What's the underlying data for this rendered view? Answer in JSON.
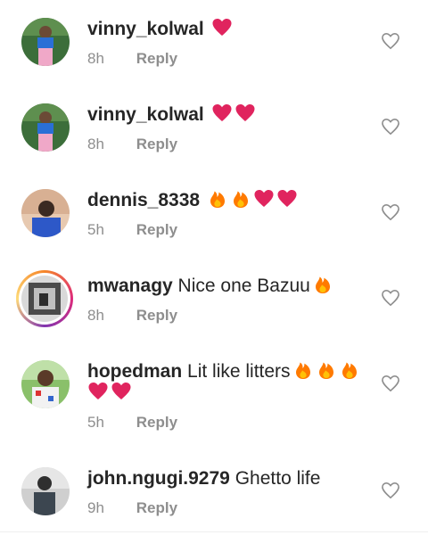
{
  "comments": [
    {
      "username": "vinny_kolwal",
      "text": "",
      "emoji": [
        "heart"
      ],
      "time": "8h",
      "reply": "Reply",
      "avatar": "photo-pink"
    },
    {
      "username": "vinny_kolwal",
      "text": "",
      "emoji": [
        "heart",
        "heart"
      ],
      "time": "8h",
      "reply": "Reply",
      "avatar": "photo-pink"
    },
    {
      "username": "dennis_8338",
      "text": "",
      "emoji": [
        "fire",
        "fire",
        "heart",
        "heart"
      ],
      "time": "5h",
      "reply": "Reply",
      "avatar": "photo-blue"
    },
    {
      "username": "mwanagy",
      "text": "Nice one Bazuu",
      "emoji": [
        "fire"
      ],
      "time": "8h",
      "reply": "Reply",
      "avatar": "photo-story"
    },
    {
      "username": "hopedman",
      "text": "Lit like litters",
      "emoji": [
        "fire",
        "fire",
        "fire"
      ],
      "emoji_line2": [
        "heart",
        "heart"
      ],
      "time": "5h",
      "reply": "Reply",
      "avatar": "photo-green"
    },
    {
      "username": "john.ngugi.9279",
      "text": "Ghetto life",
      "emoji": [],
      "time": "9h",
      "reply": "Reply",
      "avatar": "photo-grey"
    }
  ],
  "colors": {
    "heart": "#e0245e",
    "fire": "#ff7a00",
    "muted": "#8e8e8e",
    "text": "#262626"
  },
  "icons": {
    "like": "heart-outline-icon",
    "heart": "red-heart-emoji",
    "fire": "fire-emoji"
  }
}
